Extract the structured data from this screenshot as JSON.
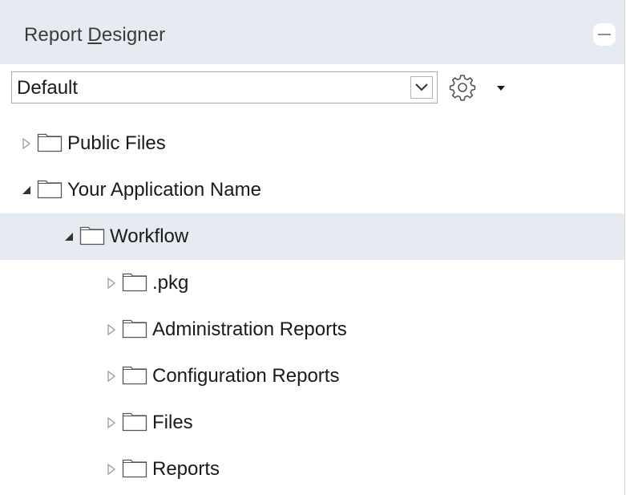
{
  "panel": {
    "title_prefix": "Report ",
    "title_mnemonic": "D",
    "title_suffix": "esigner",
    "collapse_icon": "minus-icon"
  },
  "toolbar": {
    "select_value": "Default",
    "select_arrow_icon": "chevron-down-icon",
    "settings_icon": "gear-icon",
    "menu_icon": "caret-down-icon"
  },
  "tree": {
    "items": [
      {
        "label": "Public Files",
        "state": "collapsed",
        "level": 0
      },
      {
        "label": "Your Application Name",
        "state": "expanded",
        "level": 0
      },
      {
        "label": "Workflow",
        "state": "expanded",
        "level": 1,
        "selected": true
      },
      {
        "label": ".pkg",
        "state": "collapsed",
        "level": 2
      },
      {
        "label": "Administration Reports",
        "state": "collapsed",
        "level": 2
      },
      {
        "label": "Configuration Reports",
        "state": "collapsed",
        "level": 2
      },
      {
        "label": "Files",
        "state": "collapsed",
        "level": 2
      },
      {
        "label": "Reports",
        "state": "collapsed",
        "level": 2
      }
    ]
  },
  "colors": {
    "header_bg": "#e6ebf2",
    "selected_bg": "#e6ebf2"
  }
}
